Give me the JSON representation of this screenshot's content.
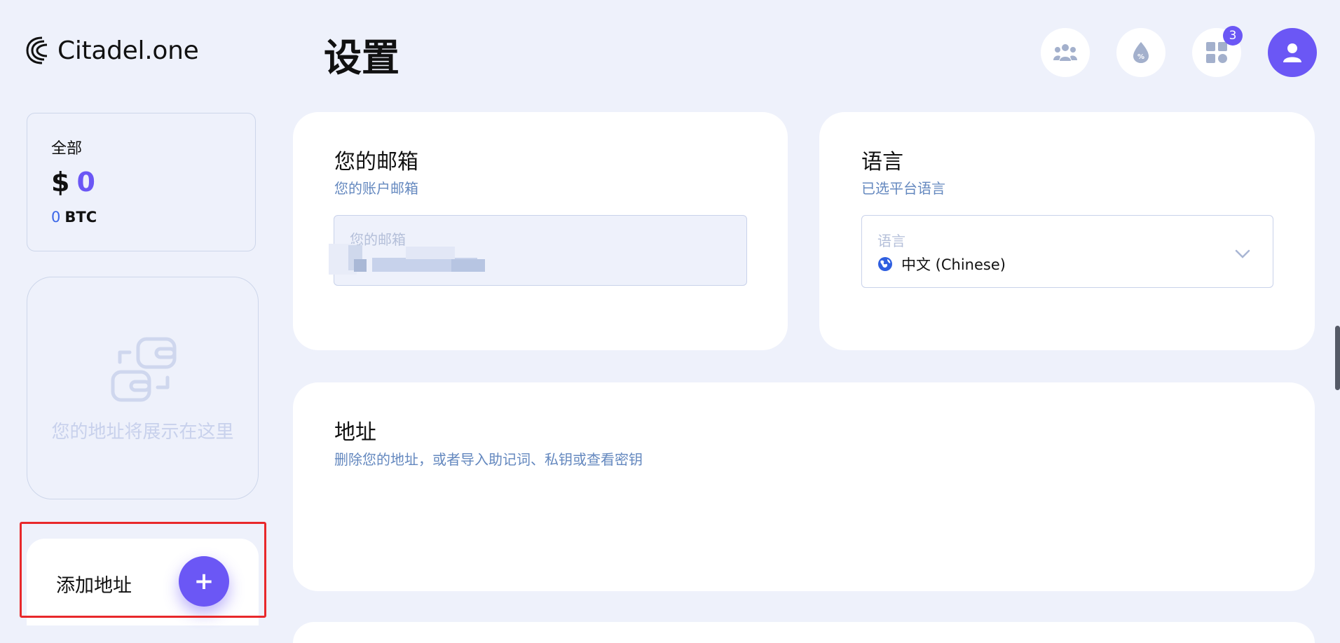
{
  "app": {
    "logo_text": "Citadel.one"
  },
  "page": {
    "title": "设置"
  },
  "header": {
    "icons": [
      "community-icon",
      "staking-percent-icon",
      "apps-grid-icon",
      "user-icon"
    ],
    "apps_badge": "3",
    "accent_color": "#6b57f5"
  },
  "sidebar": {
    "balance": {
      "label": "全部",
      "currency": "$",
      "amount": "0",
      "btc_amount": "0",
      "btc_unit": "BTC"
    },
    "empty_text": "您的地址将展示在这里",
    "add_address": {
      "label": "添加地址",
      "button": "+"
    }
  },
  "email_card": {
    "title": "您的邮箱",
    "subtitle": "您的账户邮箱",
    "field_label": "您的邮箱"
  },
  "language_card": {
    "title": "语言",
    "subtitle": "已选平台语言",
    "field_label": "语言",
    "selected": "中文 (Chinese)"
  },
  "address_card": {
    "title": "地址",
    "subtitle": "删除您的地址，或者导入助记词、私钥或查看密钥"
  }
}
